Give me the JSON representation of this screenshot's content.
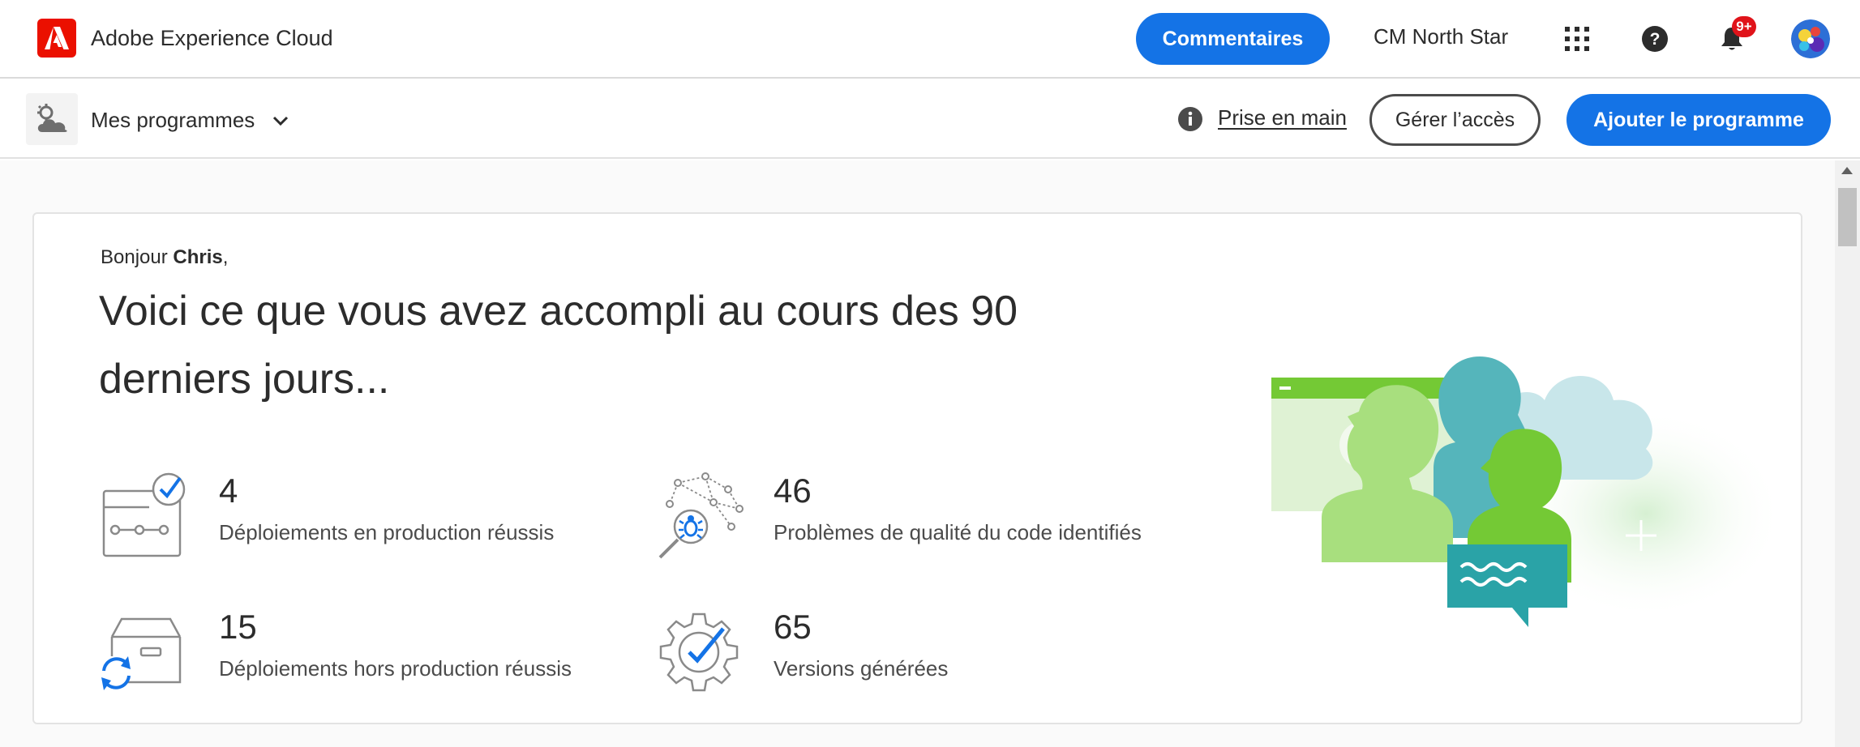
{
  "header": {
    "brand_name": "Adobe Experience Cloud",
    "feedback_label": "Commentaires",
    "org_name": "CM North Star",
    "notification_count": "9+",
    "icons": [
      "adobe-logo-icon",
      "app-grid-icon",
      "help-icon",
      "bell-icon",
      "avatar"
    ]
  },
  "subnav": {
    "programs_label": "Mes programmes",
    "getting_started_label": "Prise en main",
    "manage_access_label": "Gérer l’accès",
    "add_program_label": "Ajouter le programme"
  },
  "welcome": {
    "greeting_prefix": "Bonjour ",
    "user_name": "Chris",
    "greeting_suffix": ",",
    "headline": "Voici ce que vous avez accompli au cours des 90 derniers jours..."
  },
  "stats": [
    {
      "value": "4",
      "label": "Déploiements en production réussis",
      "icon": "deployment-check-icon"
    },
    {
      "value": "46",
      "label": "Problèmes de qualité du code identifiés",
      "icon": "code-quality-bug-icon"
    },
    {
      "value": "15",
      "label": "Déploiements hors production réussis",
      "icon": "box-refresh-icon"
    },
    {
      "value": "65",
      "label": "Versions générées",
      "icon": "gear-check-icon"
    }
  ],
  "colors": {
    "accent_blue": "#1473e6",
    "adobe_red": "#eb1000",
    "badge_red": "#e0131a",
    "text_dark": "#2c2c2c"
  }
}
